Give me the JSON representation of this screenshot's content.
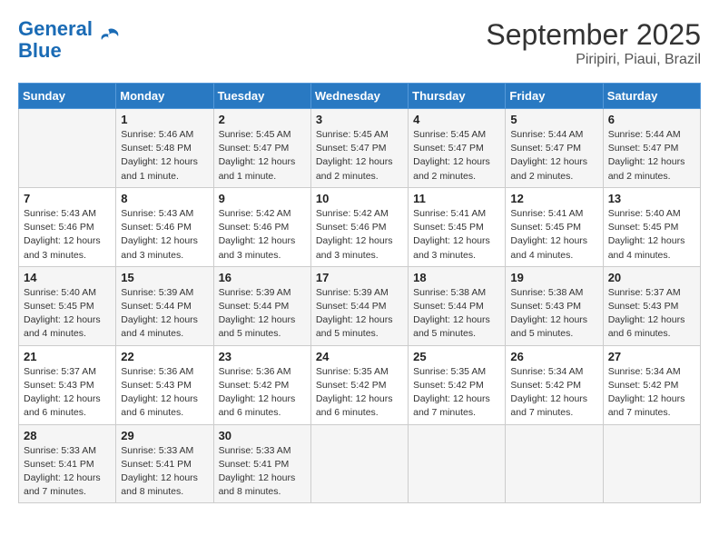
{
  "header": {
    "logo_line1": "General",
    "logo_line2": "Blue",
    "month": "September 2025",
    "location": "Piripiri, Piaui, Brazil"
  },
  "days_of_week": [
    "Sunday",
    "Monday",
    "Tuesday",
    "Wednesday",
    "Thursday",
    "Friday",
    "Saturday"
  ],
  "weeks": [
    [
      {
        "num": "",
        "info": ""
      },
      {
        "num": "1",
        "info": "Sunrise: 5:46 AM\nSunset: 5:48 PM\nDaylight: 12 hours\nand 1 minute."
      },
      {
        "num": "2",
        "info": "Sunrise: 5:45 AM\nSunset: 5:47 PM\nDaylight: 12 hours\nand 1 minute."
      },
      {
        "num": "3",
        "info": "Sunrise: 5:45 AM\nSunset: 5:47 PM\nDaylight: 12 hours\nand 2 minutes."
      },
      {
        "num": "4",
        "info": "Sunrise: 5:45 AM\nSunset: 5:47 PM\nDaylight: 12 hours\nand 2 minutes."
      },
      {
        "num": "5",
        "info": "Sunrise: 5:44 AM\nSunset: 5:47 PM\nDaylight: 12 hours\nand 2 minutes."
      },
      {
        "num": "6",
        "info": "Sunrise: 5:44 AM\nSunset: 5:47 PM\nDaylight: 12 hours\nand 2 minutes."
      }
    ],
    [
      {
        "num": "7",
        "info": "Sunrise: 5:43 AM\nSunset: 5:46 PM\nDaylight: 12 hours\nand 3 minutes."
      },
      {
        "num": "8",
        "info": "Sunrise: 5:43 AM\nSunset: 5:46 PM\nDaylight: 12 hours\nand 3 minutes."
      },
      {
        "num": "9",
        "info": "Sunrise: 5:42 AM\nSunset: 5:46 PM\nDaylight: 12 hours\nand 3 minutes."
      },
      {
        "num": "10",
        "info": "Sunrise: 5:42 AM\nSunset: 5:46 PM\nDaylight: 12 hours\nand 3 minutes."
      },
      {
        "num": "11",
        "info": "Sunrise: 5:41 AM\nSunset: 5:45 PM\nDaylight: 12 hours\nand 3 minutes."
      },
      {
        "num": "12",
        "info": "Sunrise: 5:41 AM\nSunset: 5:45 PM\nDaylight: 12 hours\nand 4 minutes."
      },
      {
        "num": "13",
        "info": "Sunrise: 5:40 AM\nSunset: 5:45 PM\nDaylight: 12 hours\nand 4 minutes."
      }
    ],
    [
      {
        "num": "14",
        "info": "Sunrise: 5:40 AM\nSunset: 5:45 PM\nDaylight: 12 hours\nand 4 minutes."
      },
      {
        "num": "15",
        "info": "Sunrise: 5:39 AM\nSunset: 5:44 PM\nDaylight: 12 hours\nand 4 minutes."
      },
      {
        "num": "16",
        "info": "Sunrise: 5:39 AM\nSunset: 5:44 PM\nDaylight: 12 hours\nand 5 minutes."
      },
      {
        "num": "17",
        "info": "Sunrise: 5:39 AM\nSunset: 5:44 PM\nDaylight: 12 hours\nand 5 minutes."
      },
      {
        "num": "18",
        "info": "Sunrise: 5:38 AM\nSunset: 5:44 PM\nDaylight: 12 hours\nand 5 minutes."
      },
      {
        "num": "19",
        "info": "Sunrise: 5:38 AM\nSunset: 5:43 PM\nDaylight: 12 hours\nand 5 minutes."
      },
      {
        "num": "20",
        "info": "Sunrise: 5:37 AM\nSunset: 5:43 PM\nDaylight: 12 hours\nand 6 minutes."
      }
    ],
    [
      {
        "num": "21",
        "info": "Sunrise: 5:37 AM\nSunset: 5:43 PM\nDaylight: 12 hours\nand 6 minutes."
      },
      {
        "num": "22",
        "info": "Sunrise: 5:36 AM\nSunset: 5:43 PM\nDaylight: 12 hours\nand 6 minutes."
      },
      {
        "num": "23",
        "info": "Sunrise: 5:36 AM\nSunset: 5:42 PM\nDaylight: 12 hours\nand 6 minutes."
      },
      {
        "num": "24",
        "info": "Sunrise: 5:35 AM\nSunset: 5:42 PM\nDaylight: 12 hours\nand 6 minutes."
      },
      {
        "num": "25",
        "info": "Sunrise: 5:35 AM\nSunset: 5:42 PM\nDaylight: 12 hours\nand 7 minutes."
      },
      {
        "num": "26",
        "info": "Sunrise: 5:34 AM\nSunset: 5:42 PM\nDaylight: 12 hours\nand 7 minutes."
      },
      {
        "num": "27",
        "info": "Sunrise: 5:34 AM\nSunset: 5:42 PM\nDaylight: 12 hours\nand 7 minutes."
      }
    ],
    [
      {
        "num": "28",
        "info": "Sunrise: 5:33 AM\nSunset: 5:41 PM\nDaylight: 12 hours\nand 7 minutes."
      },
      {
        "num": "29",
        "info": "Sunrise: 5:33 AM\nSunset: 5:41 PM\nDaylight: 12 hours\nand 8 minutes."
      },
      {
        "num": "30",
        "info": "Sunrise: 5:33 AM\nSunset: 5:41 PM\nDaylight: 12 hours\nand 8 minutes."
      },
      {
        "num": "",
        "info": ""
      },
      {
        "num": "",
        "info": ""
      },
      {
        "num": "",
        "info": ""
      },
      {
        "num": "",
        "info": ""
      }
    ]
  ]
}
